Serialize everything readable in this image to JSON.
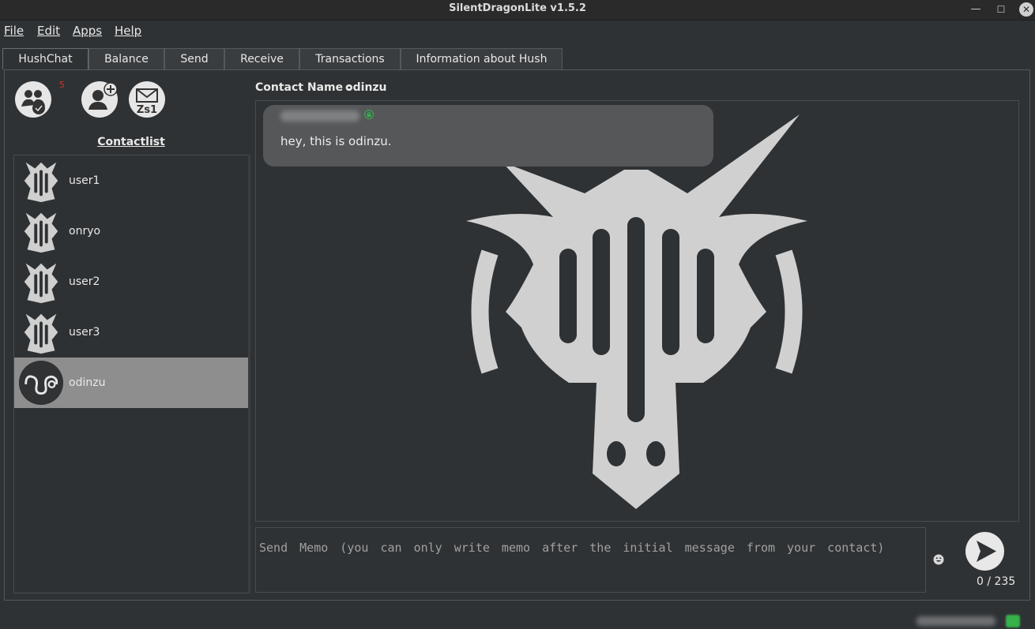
{
  "window": {
    "title": "SilentDragonLite v1.5.2",
    "minimize": "—",
    "maximize": "☐",
    "close": "✕"
  },
  "menu": [
    {
      "label": "File"
    },
    {
      "label": "Edit"
    },
    {
      "label": "Apps"
    },
    {
      "label": "Help"
    }
  ],
  "tabs": [
    {
      "label": "HushChat",
      "active": true
    },
    {
      "label": "Balance"
    },
    {
      "label": "Send"
    },
    {
      "label": "Receive"
    },
    {
      "label": "Transactions"
    },
    {
      "label": "Information about Hush"
    }
  ],
  "toolbar": {
    "requests_badge": "5"
  },
  "contacts": {
    "title": "Contactlist",
    "items": [
      {
        "name": "user1",
        "avatar": "dragon-logo-avatar"
      },
      {
        "name": "onryo",
        "avatar": "dragon-logo-avatar"
      },
      {
        "name": "user2",
        "avatar": "dragon-logo-avatar"
      },
      {
        "name": "user3",
        "avatar": "dragon-logo-avatar"
      },
      {
        "name": "odinzu",
        "avatar": "squiggle-avatar",
        "selected": true
      }
    ]
  },
  "chat": {
    "contact_label": "Contact Name :",
    "contact_name": "odinzu",
    "messages": [
      {
        "text": "hey, this is odinzu.",
        "encrypted": true
      }
    ]
  },
  "compose": {
    "placeholder": "Send Memo (you can only write memo after the initial message from your contact)",
    "counter": "0 / 235"
  },
  "colors": {
    "background": "#2f3234",
    "selected": "#8e8e8e",
    "bubble": "#555759",
    "badge": "#d03030",
    "status_ok": "#37b14a"
  }
}
